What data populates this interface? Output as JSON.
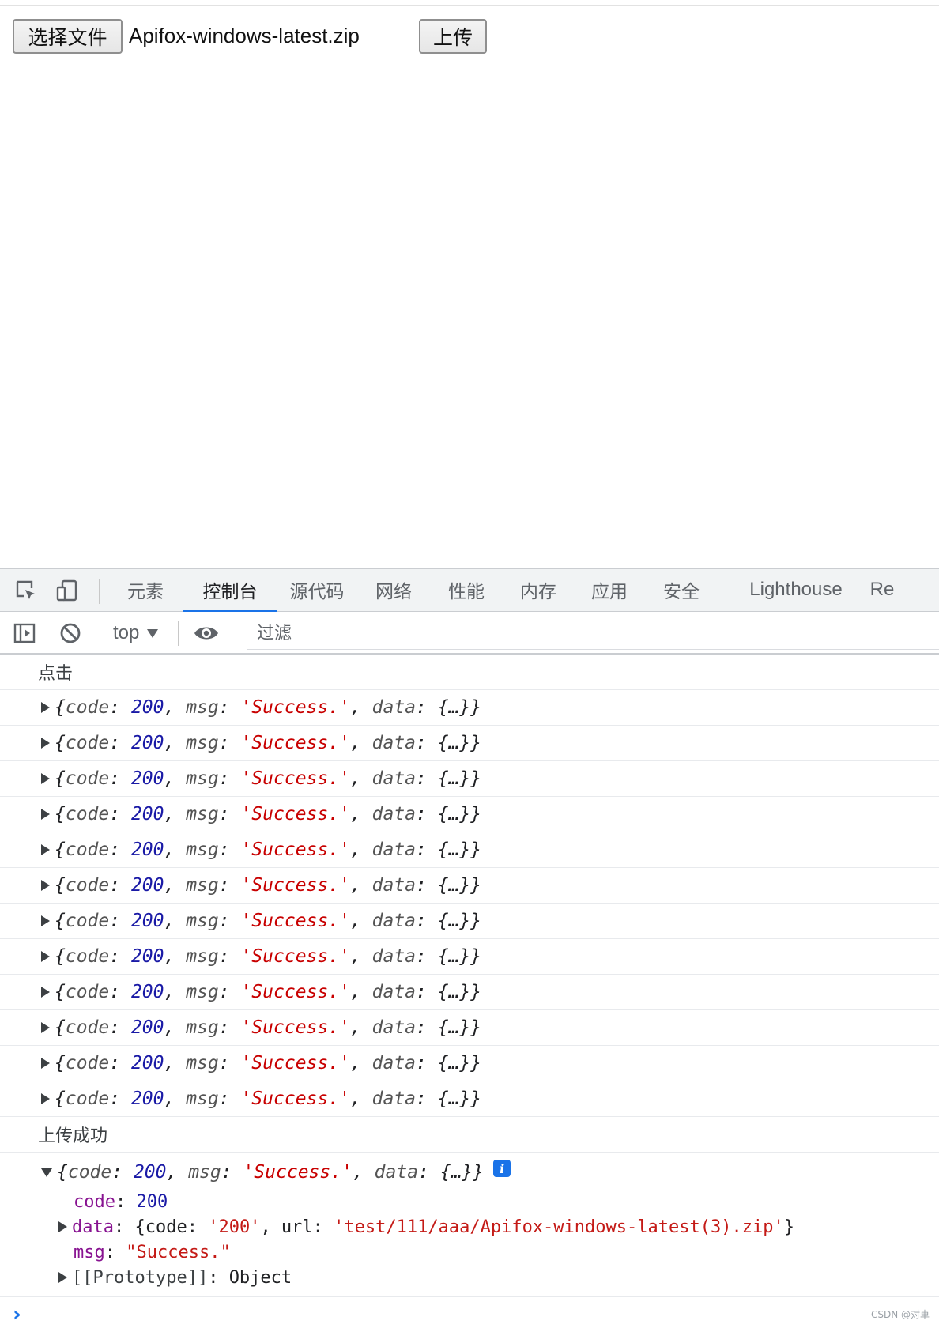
{
  "page": {
    "choose_button_label": "选择文件",
    "file_name": "Apifox-windows-latest.zip",
    "upload_button_label": "上传"
  },
  "devtools": {
    "tabs": [
      {
        "label": "元素",
        "active": false
      },
      {
        "label": "控制台",
        "active": true
      },
      {
        "label": "源代码",
        "active": false
      },
      {
        "label": "网络",
        "active": false
      },
      {
        "label": "性能",
        "active": false
      },
      {
        "label": "内存",
        "active": false
      },
      {
        "label": "应用",
        "active": false
      },
      {
        "label": "安全",
        "active": false
      },
      {
        "label": "Lighthouse",
        "active": false
      },
      {
        "label": "Re",
        "active": false
      }
    ],
    "toolbar": {
      "context": "top",
      "filter_placeholder": "过滤"
    },
    "accent_color": "#1a73e8"
  },
  "console": {
    "click_log": "点击",
    "object_log": {
      "open": "{",
      "code_key": "code",
      "code_value": "200",
      "msg_key": "msg",
      "msg_value": "'Success.'",
      "data_key": "data",
      "data_value": "{…}",
      "close": "}"
    },
    "collapsed_count": 12,
    "success_log": "上传成功",
    "expanded": {
      "info_icon": "i",
      "props": {
        "code_name": "code",
        "code_value": "200",
        "data_name": "data",
        "data_preview_open": "{code: ",
        "data_code": "'200'",
        "data_sep": ", url: ",
        "data_url": "'test/111/aaa/Apifox-windows-latest(3).zip'",
        "data_preview_close": "}",
        "msg_name": "msg",
        "msg_value": "\"Success.\"",
        "proto_name": "[[Prototype]]",
        "proto_value": "Object"
      }
    }
  },
  "watermark": "CSDN @对車"
}
